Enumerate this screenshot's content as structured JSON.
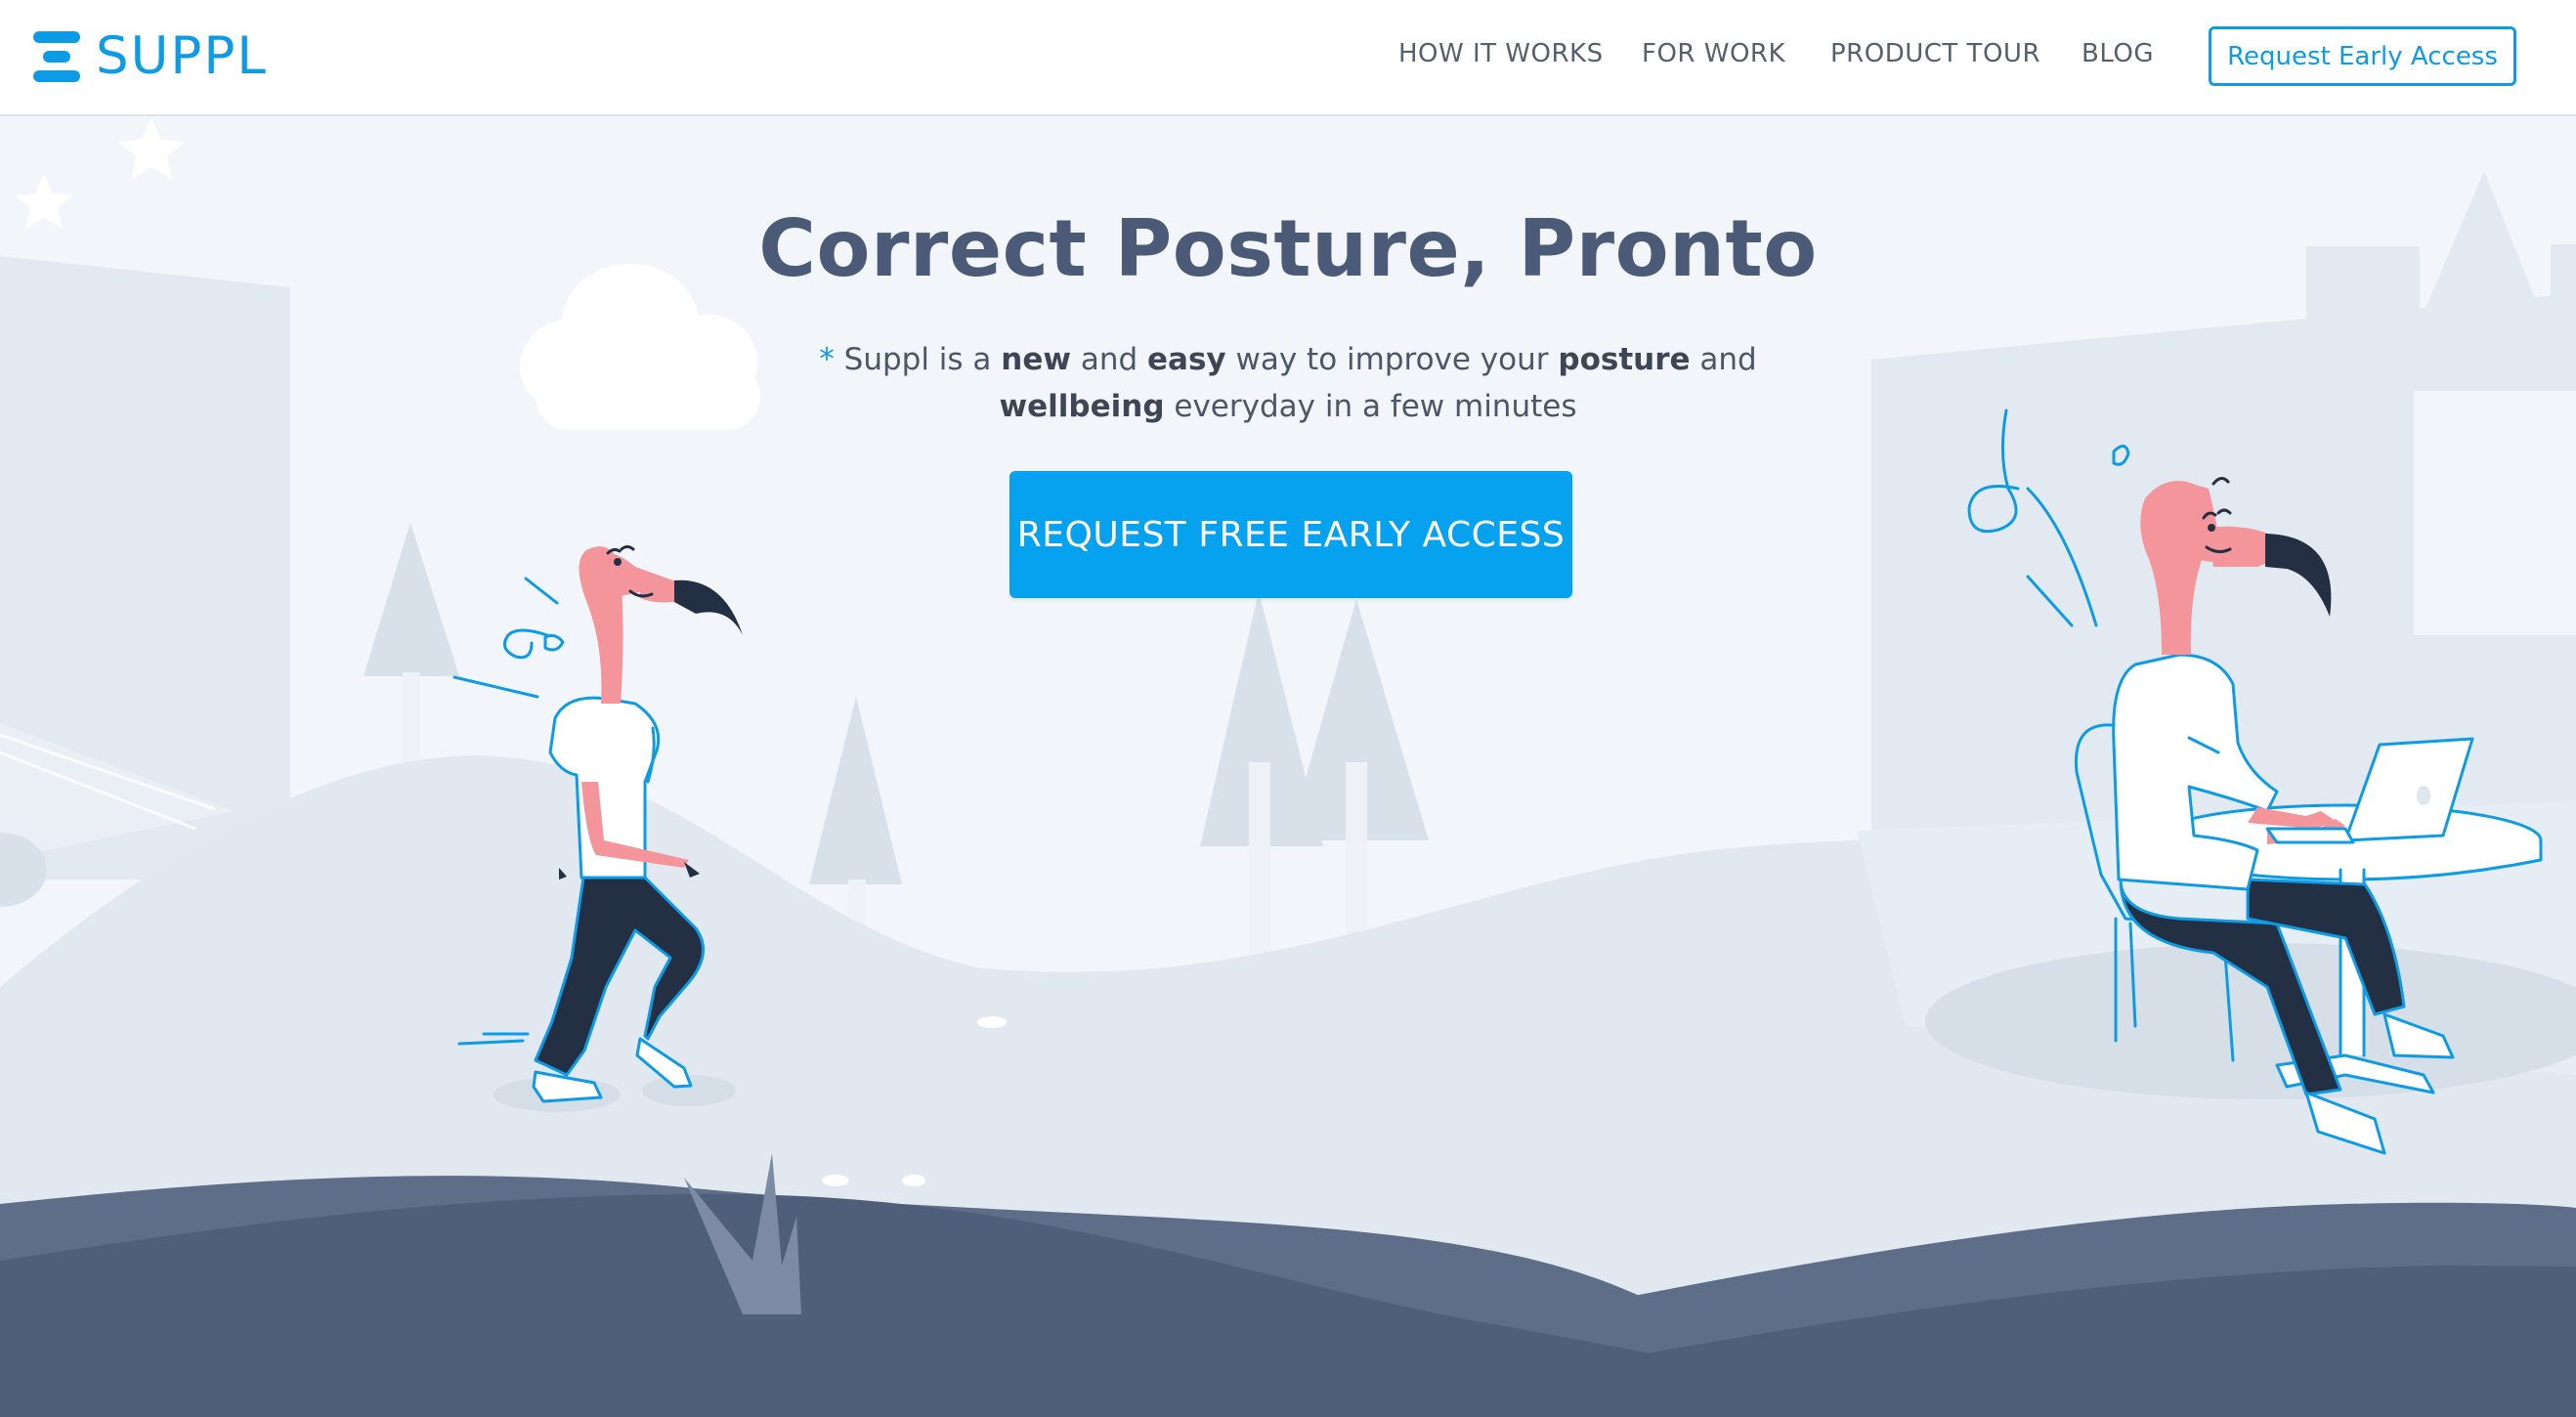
{
  "brand": {
    "name": "SUPPL",
    "color": "#0d9be6"
  },
  "nav": {
    "items": [
      {
        "label": "HOW IT WORKS"
      },
      {
        "label": "FOR WORK"
      },
      {
        "label": "PRODUCT TOUR"
      },
      {
        "label": "BLOG"
      }
    ],
    "cta_label": "Request Early Access"
  },
  "hero": {
    "title": "Correct Posture, Pronto",
    "subtitle": {
      "asterisk": "*",
      "p1": " Suppl is a ",
      "b1": "new",
      "p2": " and ",
      "b2": "easy",
      "p3": " way to improve your ",
      "b3": "posture",
      "p4": " and ",
      "b4": "wellbeing",
      "p5": " everyday in a few minutes"
    },
    "cta_label": "REQUEST FREE EARLY ACCESS"
  },
  "colors": {
    "accent": "#06a1ef",
    "title": "#4a5a77",
    "flamingo": "#f4949b",
    "ground_dark": "#4f5f7a",
    "background": "#f2f6fa"
  },
  "illustration": {
    "characters": [
      "walking-flamingo",
      "flamingo-at-laptop"
    ],
    "icons": [
      "star-icon",
      "cloud-icon",
      "tree-icon",
      "grass-icon",
      "laptop-icon"
    ]
  }
}
